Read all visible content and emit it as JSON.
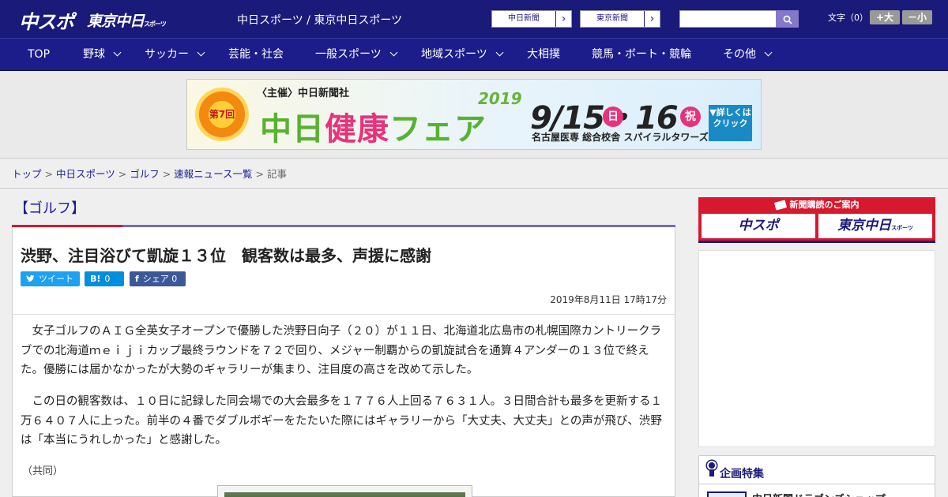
{
  "header": {
    "logo_chuspo": "中スポ",
    "logo_tokyo": "東京中日",
    "logo_tokyo_sub": "スポーツ",
    "site_name": "中日スポーツ / 東京中日スポーツ",
    "paper_links": [
      {
        "label": "中日新聞",
        "arrow": "›"
      },
      {
        "label": "東京新聞",
        "arrow": "›"
      }
    ],
    "search": {
      "placeholder": "",
      "button_icon": "search-icon"
    },
    "font_size": {
      "label": "文字（0）",
      "large_label": "+大",
      "small_label": "－小"
    }
  },
  "nav": {
    "items": [
      {
        "label": "TOP"
      },
      {
        "label": "野球"
      },
      {
        "label": "サッカー"
      },
      {
        "label": "芸能・社会"
      },
      {
        "label": "一般スポーツ"
      },
      {
        "label": "地域スポーツ"
      },
      {
        "label": "大相撲"
      },
      {
        "label": "競馬・ボート・競輪"
      },
      {
        "label": "その他"
      }
    ]
  },
  "banner": {
    "sponsor": "〈主催〉中日新聞社",
    "edition": "第7回",
    "title_a": "中日",
    "title_b": "健康",
    "title_c": "フェア",
    "year": "2019",
    "date": "9/15・16",
    "day1": "日",
    "day2": "祝",
    "venue": "名古屋医専 総合校舎 スパイラルタワーズ",
    "cta": "▼詳しくはクリック"
  },
  "breadcrumb": {
    "items": [
      "トップ",
      "中日スポーツ",
      "ゴルフ",
      "速報ニュース一覧"
    ],
    "current": "記事",
    "separator": ">"
  },
  "article": {
    "category": "【ゴルフ】",
    "headline": "渋野、注目浴びて凱旋１３位　観客数は最多、声援に感謝",
    "share": {
      "tweet_label": "ツイート",
      "hatena_glyph": "B!",
      "hatena_count": "0",
      "facebook_glyph": "f",
      "facebook_label": "シェア 0"
    },
    "published": "2019年8月11日 17時17分",
    "paragraphs": [
      "女子ゴルフのＡＩＧ全英女子オープンで優勝した渋野日向子（２０）が１１日、北海道北広島市の札幌国際カントリークラブでの北海道ｍｅｉｊｉカップ最終ラウンドを７２で回り、メジャー制覇からの凱旋試合を通算４アンダーの１３位で終えた。優勝には届かなかったが大勢のギャラリーが集まり、注目度の高さを改めて示した。",
      "この日の観客数は、１０日に記録した同会場での大会最多を１７７６人上回る７６３１人。３日間合計も最多を更新する１万６４０７人に上った。前半の４番でダブルボギーをたたいた際にはギャラリーから「大丈夫、大丈夫」との声が飛び、渋野は「本当にうれしかった」と感謝した。"
    ],
    "credit": "（共同）"
  },
  "sidebar": {
    "subscribe": {
      "header": "新聞購読のご案内",
      "chuspo": "中スポ",
      "tokyo": "東京中日",
      "tokyo_sub": "スポーツ"
    },
    "feature": {
      "title": "企画特集",
      "item": "中日新聞ドラゴンズショップ"
    }
  },
  "colors": {
    "header_bg": "#1a1a7a",
    "nav_bg": "#1c1c8a",
    "accent_red": "#d8182f",
    "accent_purple": "#7b6ab8",
    "link": "#1a1a9a"
  }
}
